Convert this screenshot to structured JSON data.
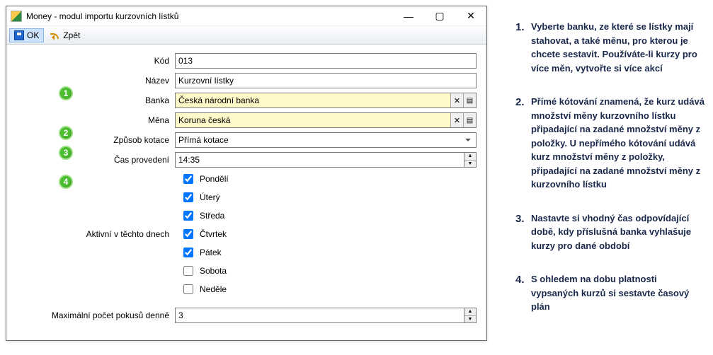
{
  "window": {
    "title": "Money - modul importu kurzovních lístků"
  },
  "toolbar": {
    "ok_label": "OK",
    "back_label": "Zpět"
  },
  "form": {
    "kod_label": "Kód",
    "kod_value": "013",
    "nazev_label": "Název",
    "nazev_value": "Kurzovní lístky",
    "banka_label": "Banka",
    "banka_value": "Česká národní banka",
    "mena_label": "Měna",
    "mena_value": "Koruna česká",
    "kotace_label": "Způsob kotace",
    "kotace_value": "Přímá kotace",
    "cas_label": "Čas provedení",
    "cas_value": "14:35",
    "aktivni_label": "Aktivní v těchto dnech",
    "pokusy_label": "Maximální počet pokusů denně",
    "pokusy_value": "3",
    "days": {
      "po": "Pondělí",
      "ut": "Úterý",
      "st": "Středa",
      "ct": "Čtvrtek",
      "pa": "Pátek",
      "so": "Sobota",
      "ne": "Neděle"
    }
  },
  "marks": {
    "m1": "1",
    "m2": "2",
    "m3": "3",
    "m4": "4"
  },
  "help": {
    "i1": "Vyberte banku, ze které se lístky mají stahovat, a také měnu, pro kterou je chcete sestavit. Používáte-li kurzy pro více měn, vytvořte si více akcí",
    "i2": "Přímé kótování znamená, že kurz udává množství měny kurzovního lístku připadající na zadané množství měny z položky. U nepřímého kótování udává kurz množství měny z položky, připadající na zadané množství měny z kurzovního lístku",
    "i3": "Nastavte si vhodný čas odpovídající době, kdy příslušná banka vyhlašuje kurzy pro dané období",
    "i4": "S ohledem na dobu platnosti vypsaných kurzů si sestavte časový plán"
  }
}
